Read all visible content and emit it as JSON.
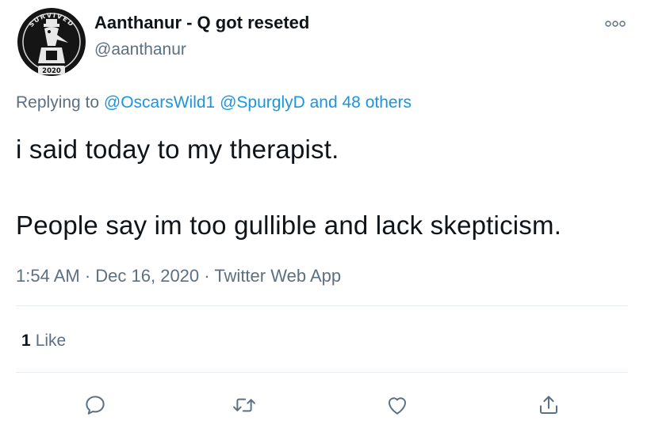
{
  "tweet": {
    "author": {
      "display_name": "Aanthanur - Q got reseted",
      "handle": "@aanthanur",
      "avatar": {
        "icon": "survived-2020-badge",
        "top_text": "SURVIVED",
        "bottom_text": "2020"
      }
    },
    "more_icon": "more-options-icon",
    "replying": {
      "prefix": "Replying to",
      "mention_1": "@OscarsWild1",
      "mention_2": "@SpurglyD",
      "others": "and 48 others"
    },
    "body": {
      "line_1": "i said today to my therapist.",
      "line_2": "People say im too gullible and lack skepticism."
    },
    "meta": {
      "time": "1:54 AM",
      "separator_1": " · ",
      "date": "Dec 16, 2020",
      "separator_2": " · ",
      "app": "Twitter Web App"
    },
    "stats": {
      "likes_count": "1",
      "likes_label": "Like"
    },
    "actions": {
      "reply": "reply-icon",
      "retweet": "retweet-icon",
      "like": "heart-icon",
      "share": "share-icon"
    }
  },
  "colors": {
    "text_primary": "#0f1419",
    "text_secondary": "#5b7083",
    "link": "#1b95e0",
    "divider": "#e6ecf0",
    "icon": "#5b7083"
  }
}
